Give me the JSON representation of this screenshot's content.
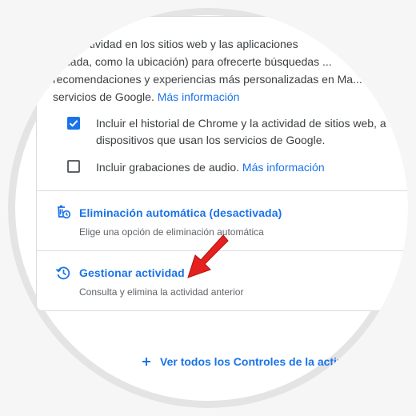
{
  "activity_intro": {
    "lines": [
      "... tu actividad en los sitios web y las aplicaciones",
      "...ciada, como la ubicación) para ofrecerte búsquedas ...",
      "recomendaciones y experiencias más personalizadas en Ma...",
      "servicios de Google."
    ],
    "more_info_label": "Más información"
  },
  "options": [
    {
      "checked": true,
      "line1": "Incluir el historial de Chrome y la actividad de sitios web, a",
      "line2": "dispositivos que usan los servicios de Google."
    },
    {
      "checked": false,
      "label": "Incluir grabaciones de audio.",
      "more_info_label": "Más información"
    }
  ],
  "auto_delete": {
    "icon": "auto-delete-icon",
    "title": "Eliminación automática (desactivada)",
    "subtitle": "Elige una opción de eliminación automática"
  },
  "manage_activity": {
    "icon": "history-icon",
    "title": "Gestionar actividad",
    "subtitle": "Consulta y elimina la actividad anterior"
  },
  "view_all": {
    "icon": "plus-icon",
    "label": "Ver todos los Controles de la activi..."
  },
  "colors": {
    "accent": "#1a73e8",
    "annotation_arrow": "#e5201e"
  }
}
